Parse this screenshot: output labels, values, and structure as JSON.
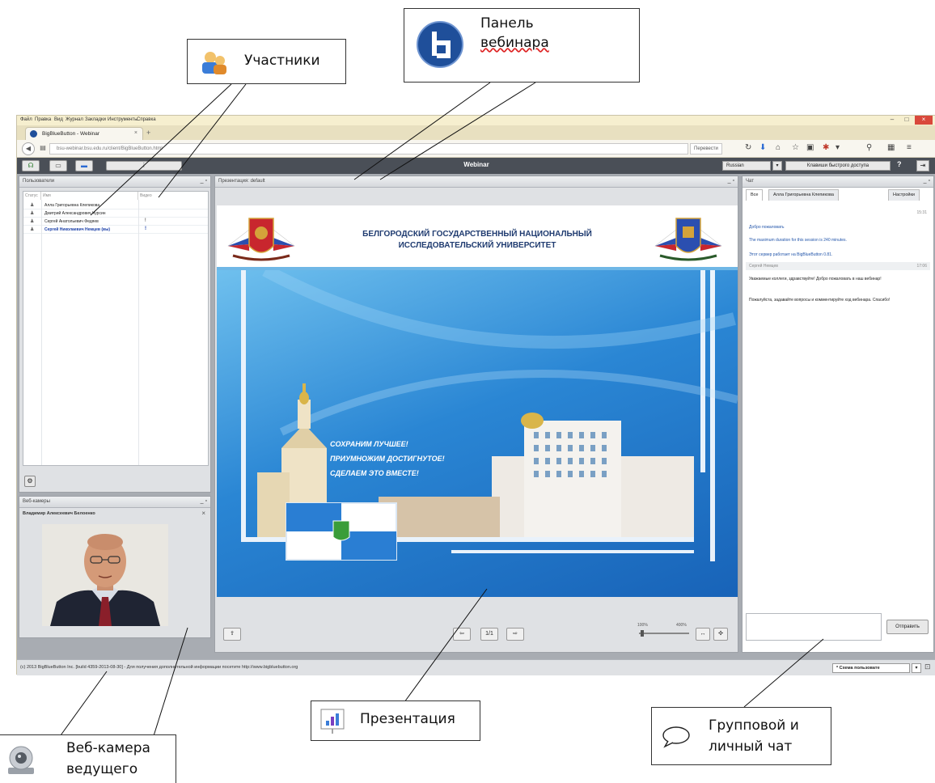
{
  "callouts": {
    "participants": "Участники",
    "webinar_panel_1": "Панель",
    "webinar_panel_2": "вебинара",
    "presentation": "Презентация",
    "chat_1": "Групповой и",
    "chat_2": "личный чат",
    "webcam_1": "Веб-камера",
    "webcam_2": "ведущего"
  },
  "browser": {
    "menu": [
      "Файл",
      "Правка",
      "Вид",
      "Журнал",
      "Закладки",
      "Инструменты",
      "Справка"
    ],
    "tab_title": "BigBlueButton - Webinar",
    "url": "bsu-webinar.bsu.edu.ru/client/BigBlueButton.html",
    "translate_label": "Перевести"
  },
  "bbb": {
    "toolbar_title": "Webinar",
    "language": "Russian",
    "shortcuts_label": "Клавиши быстрого доступа",
    "help_label": "?"
  },
  "users": {
    "title": "Пользователи",
    "col_status": "Статус",
    "col_name": "Имя",
    "col_video": "Видео",
    "rows": [
      {
        "name": "Алла Григорьевна Клепикова",
        "video": ""
      },
      {
        "name": "Дмитрий Александрович Чурсин",
        "video": ""
      },
      {
        "name": "Сергей Анатольевич Федяев",
        "video": "!"
      },
      {
        "name": "Сергей Николаевич Немцев (вы)",
        "video": "!"
      }
    ]
  },
  "webcam": {
    "title": "Веб-камеры",
    "presenter_name": "Владимир Алексеевич Белоенко"
  },
  "presentation": {
    "title": "Презентация: default",
    "slide_title_1": "БЕЛГОРОДСКИЙ ГОСУДАРСТВЕННЫЙ НАЦИОНАЛЬНЫЙ",
    "slide_title_2": "ИССЛЕДОВАТЕЛЬСКИЙ УНИВЕРСИТЕТ",
    "slogan_1": "СОХРАНИМ ЛУЧШЕЕ!",
    "slogan_2": "ПРИУМНОЖИМ ДОСТИГНУТОЕ!",
    "slogan_3": "СДЕЛАЕМ ЭТО ВМЕСТЕ!",
    "page_indicator": "1/1",
    "zoom_min": "100%",
    "zoom_max": "400%"
  },
  "chat": {
    "title": "Чат",
    "tabs": [
      "Все",
      "Алла Григорьевна Клепикова",
      "Настройки"
    ],
    "time_1": "15:31",
    "msg_welcome": "Добро пожаловать",
    "msg_duration": "The maximum duration for this session is 240 minutes.",
    "msg_server": "Этот сервер работает на BigBlueButton 0.81.",
    "sender": "Сергей Немцев",
    "time_2": "17:06",
    "msg_1": "Уважаемые коллеги, здравствуйте! Добро пожаловать в наш вебинар!",
    "msg_2": "Пожалуйста, задавайте вопросы и комментируйте ход вебинара. Спасибо!",
    "send_label": "Отправить"
  },
  "footer": {
    "text": "(c) 2013 BigBlueButton Inc. [build 4359-2013-08-30] - Для получения дополнительной информации посетите http://www.bigbluebutton.org",
    "layout_label": "* Схема пользовате"
  }
}
